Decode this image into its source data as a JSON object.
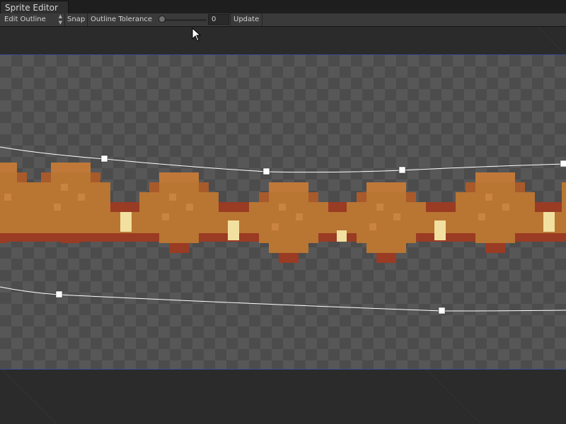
{
  "window": {
    "tab_title": "Sprite Editor"
  },
  "toolbar": {
    "mode_dropdown": "Edit Outline",
    "snap_label": "Snap",
    "tolerance_label": "Outline Tolerance",
    "tolerance_value": "0",
    "tolerance_fraction": 0,
    "update_label": "Update"
  },
  "colors": {
    "selection_border": "#3c4f93",
    "outline": "#ffffff",
    "sprite_body": "#b97532",
    "sprite_dark": "#9a3b24",
    "sprite_light": "#f2e0a0"
  }
}
